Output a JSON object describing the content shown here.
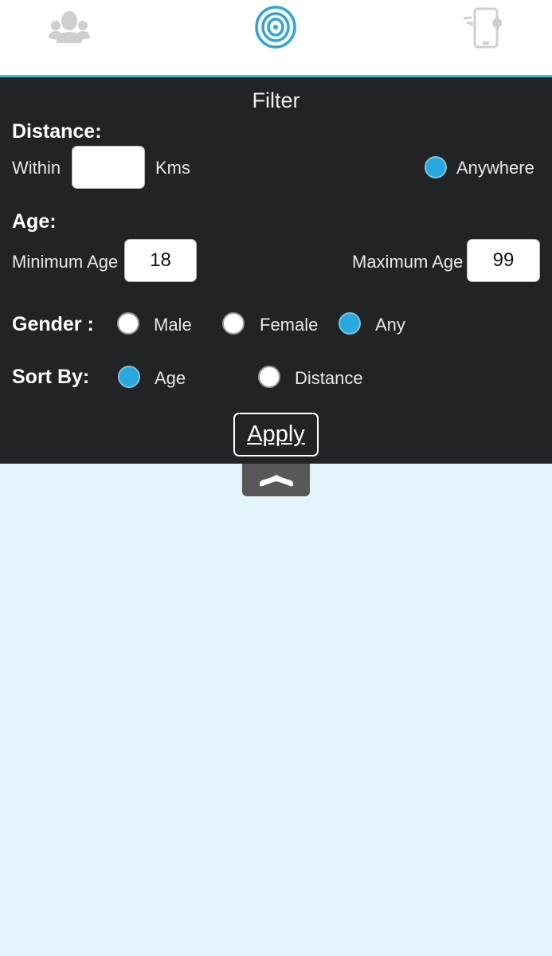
{
  "nav": {
    "tabs": [
      {
        "name": "people",
        "icon": "people-icon",
        "active": false
      },
      {
        "name": "radar",
        "icon": "radar-icon",
        "active": true
      },
      {
        "name": "phone-settings",
        "icon": "phone-settings-icon",
        "active": false
      }
    ],
    "active_color": "#2fa5d6",
    "inactive_color": "#cccccc"
  },
  "filter": {
    "title": "Filter",
    "distance": {
      "label": "Distance:",
      "within_label": "Within",
      "value": "",
      "unit_label": "Kms",
      "anywhere_label": "Anywhere",
      "anywhere_checked": true
    },
    "age": {
      "label": "Age:",
      "min_label": "Minimum Age",
      "min_value": "18",
      "max_label": "Maximum Age",
      "max_value": "99"
    },
    "gender": {
      "label": "Gender :",
      "options": [
        "Male",
        "Female",
        "Any"
      ],
      "selected": "Any"
    },
    "sort": {
      "label": "Sort By:",
      "options": [
        "Age",
        "Distance"
      ],
      "selected": "Age"
    },
    "apply_label": "Apply"
  },
  "colors": {
    "panel_bg": "#222325",
    "accent": "#28a8dd",
    "page_bg": "#e3f4fc"
  }
}
